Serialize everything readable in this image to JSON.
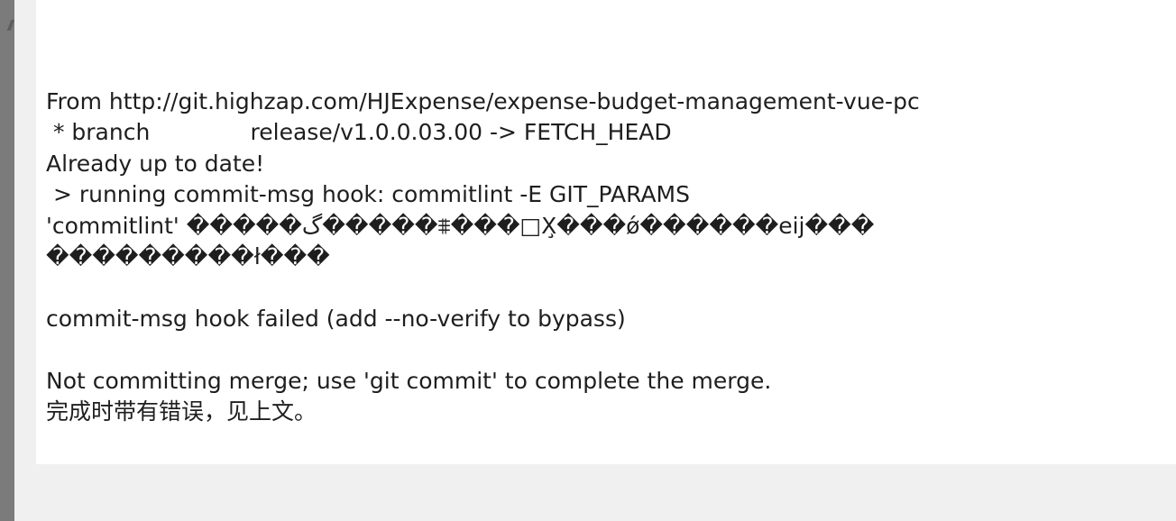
{
  "console": {
    "lines": [
      "From http://git.highzap.com/HJExpense/expense-budget-management-vue-pc",
      " * branch              release/v1.0.0.03.00 -> FETCH_HEAD",
      "Already up to date!",
      " > running commit-msg hook: commitlint -E GIT_PARAMS",
      "'commitlint' �����گ�����⩨���□X̧���ǿ������eij���",
      "���������ł���",
      "",
      "commit-msg hook failed (add --no-verify to bypass)",
      "",
      "Not committing merge; use 'git commit' to complete the merge.",
      "完成时带有错误，见上文。"
    ]
  }
}
